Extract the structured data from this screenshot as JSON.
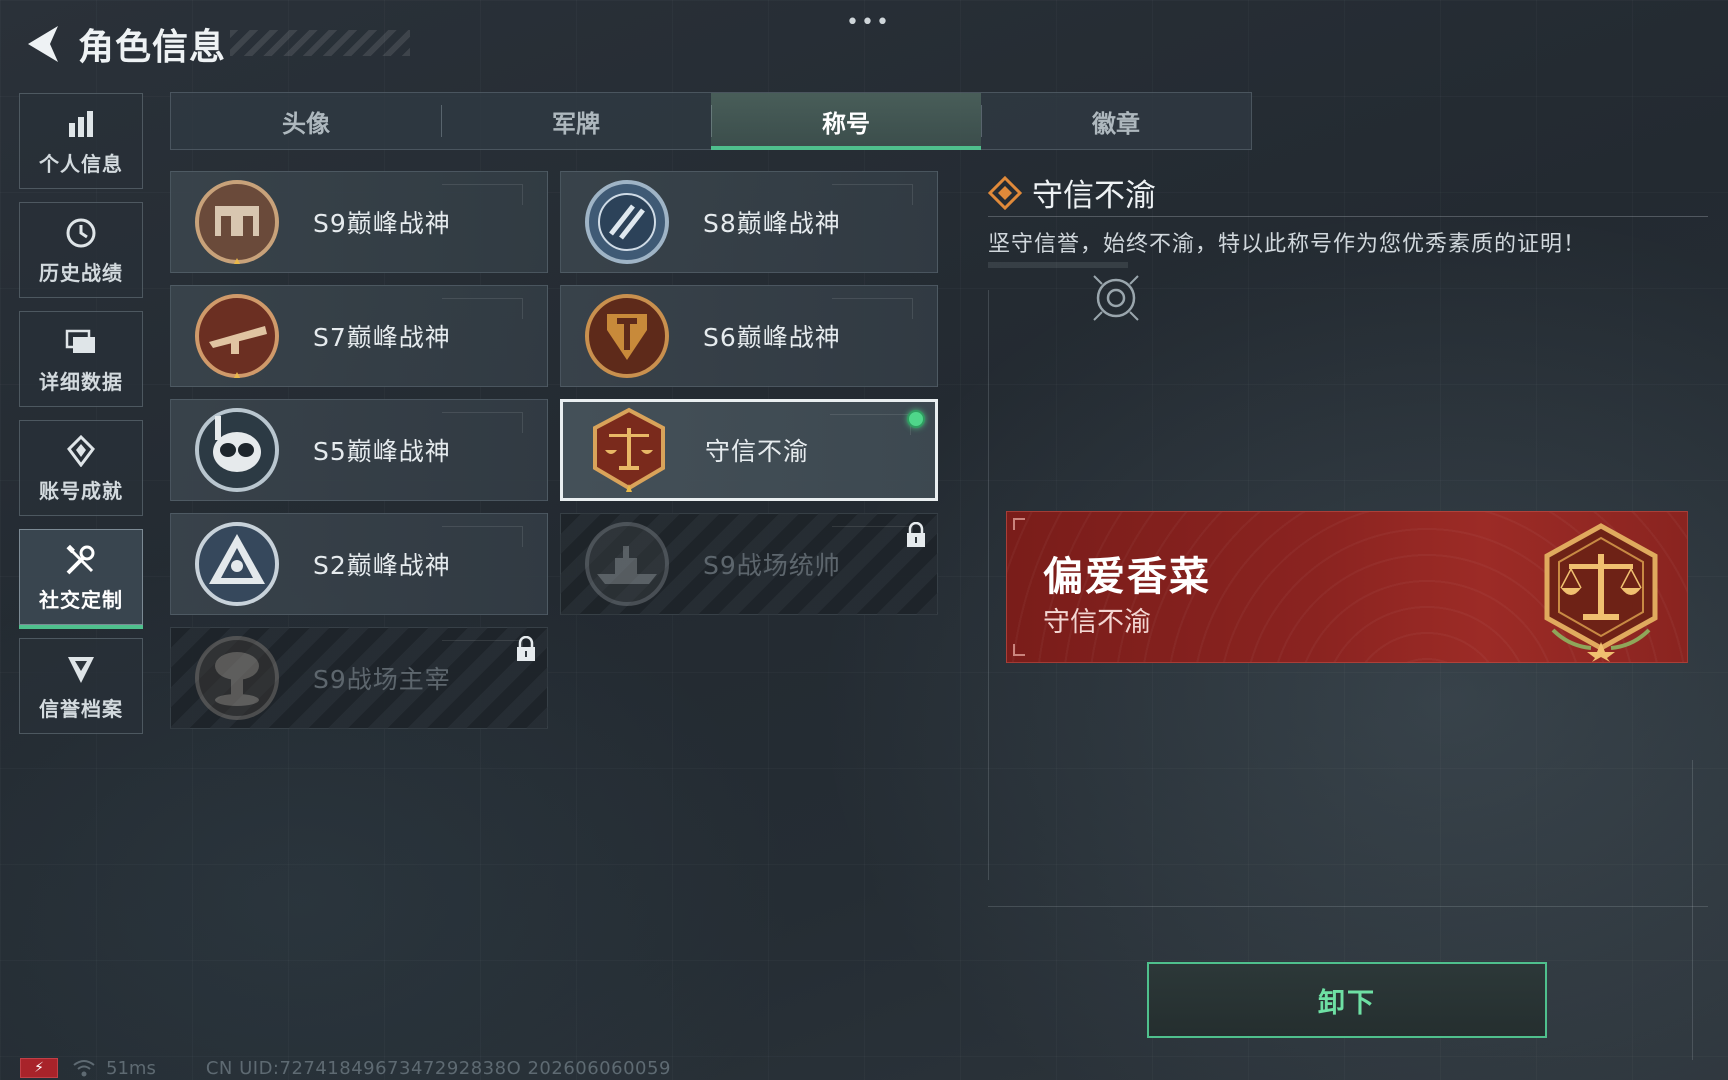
{
  "header": {
    "title": "角色信息",
    "more_label": "•••"
  },
  "sidebar": {
    "items": [
      {
        "label": "个人信息",
        "icon": "bar-chart-icon",
        "active": false
      },
      {
        "label": "历史战绩",
        "icon": "clock-icon",
        "active": false
      },
      {
        "label": "详细数据",
        "icon": "folder-icon",
        "active": false
      },
      {
        "label": "账号成就",
        "icon": "medal-icon",
        "active": false
      },
      {
        "label": "社交定制",
        "icon": "tools-icon",
        "active": true
      },
      {
        "label": "信誉档案",
        "icon": "shield-badge-icon",
        "active": false
      }
    ]
  },
  "tabs": [
    {
      "label": "头像",
      "active": false
    },
    {
      "label": "军牌",
      "active": false
    },
    {
      "label": "称号",
      "active": true
    },
    {
      "label": "徽章",
      "active": false
    }
  ],
  "titles": [
    {
      "label": "S9巅峰战神",
      "emblem": "fortress-emblem-icon",
      "locked": false,
      "selected": false
    },
    {
      "label": "S8巅峰战神",
      "emblem": "blue-stripe-emblem-icon",
      "locked": false,
      "selected": false
    },
    {
      "label": "S7巅峰战神",
      "emblem": "rifle-emblem-icon",
      "locked": false,
      "selected": false
    },
    {
      "label": "S6巅峰战神",
      "emblem": "t-shield-emblem-icon",
      "locked": false,
      "selected": false
    },
    {
      "label": "S5巅峰战神",
      "emblem": "diver-skull-emblem-icon",
      "locked": false,
      "selected": false
    },
    {
      "label": "守信不渝",
      "emblem": "scales-emblem-icon",
      "locked": false,
      "selected": true,
      "equipped": true
    },
    {
      "label": "S2巅峰战神",
      "emblem": "triangle-emblem-icon",
      "locked": false,
      "selected": false
    },
    {
      "label": "S9战场统帅",
      "emblem": "warship-emblem-icon",
      "locked": true,
      "selected": false
    },
    {
      "label": "S9战场主宰",
      "emblem": "mushroom-cloud-emblem-icon",
      "locked": true,
      "selected": false
    }
  ],
  "detail": {
    "title": "守信不渝",
    "description": "坚守信誉，始终不渝，特以此称号作为您优秀素质的证明！"
  },
  "nameplate": {
    "player_name": "偏爱香菜",
    "title": "守信不渝"
  },
  "actions": {
    "unequip_label": "卸下"
  },
  "status": {
    "ping": "51ms",
    "uid": "CN UID:7274184967347292838O 202606060059"
  },
  "colors": {
    "accent_green": "#4fc08d",
    "nameplate_red": "#8a2320",
    "equipped_dot": "#4fd68a"
  }
}
